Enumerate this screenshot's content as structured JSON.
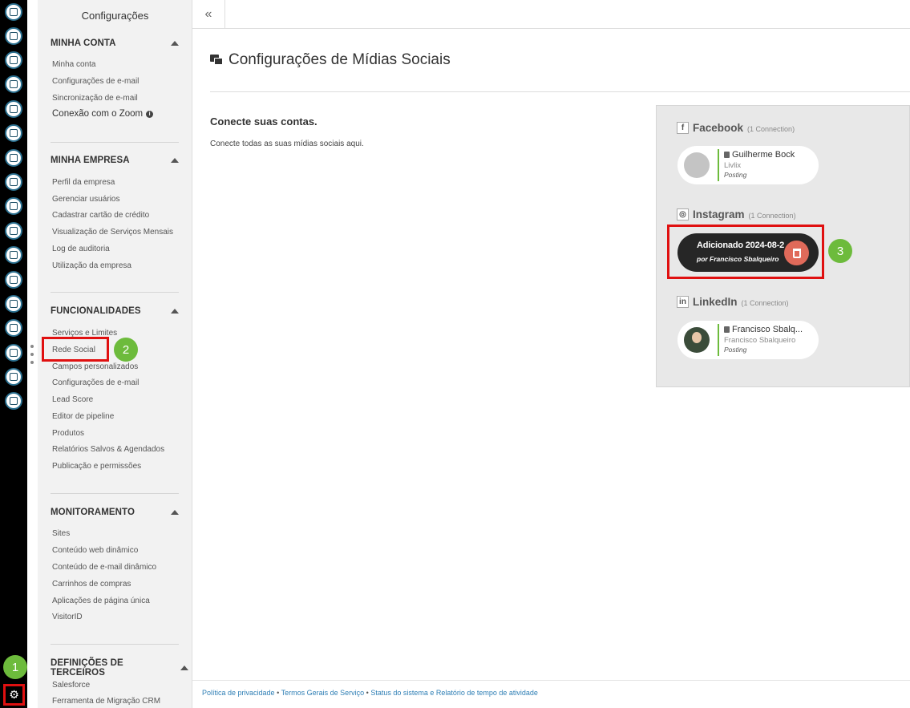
{
  "sidebar": {
    "title": "Configurações",
    "sections": [
      {
        "heading": "MINHA CONTA",
        "items": [
          "Minha conta",
          "Configurações de e-mail",
          "Sincronização de e-mail",
          "Conexão com o Zoom"
        ]
      },
      {
        "heading": "MINHA EMPRESA",
        "items": [
          "Perfil da empresa",
          "Gerenciar usuários",
          "Cadastrar cartão de crédito",
          "Visualização de Serviços Mensais",
          "Log de auditoria",
          "Utilização da empresa"
        ]
      },
      {
        "heading": "FUNCIONALIDADES",
        "items": [
          "Serviços e Limites",
          "Rede Social",
          "Campos personalizados",
          "Configurações de e-mail",
          "Lead Score",
          "Editor de pipeline",
          "Produtos",
          "Relatórios Salvos & Agendados",
          "Publicação e permissões"
        ]
      },
      {
        "heading": "MONITORAMENTO",
        "items": [
          "Sites",
          "Conteúdo web dinâmico",
          "Conteúdo de e-mail dinâmico",
          "Carrinhos de compras",
          "Aplicações de página única",
          "VisitorID"
        ]
      },
      {
        "heading": "DEFINIÇÕES DE TERCEIROS",
        "items": [
          "Salesforce",
          "Ferramenta de Migração CRM"
        ]
      }
    ]
  },
  "rail": {
    "icons": [
      "contacts-icon",
      "inbox-icon",
      "clipboard-icon",
      "map-icon",
      "flow-icon",
      "list-icon",
      "megaphone-icon",
      "face-icon",
      "thumbs-up-icon",
      "images-icon",
      "calendar-icon",
      "handshake-icon",
      "trend-icon",
      "support-icon",
      "add-user-icon",
      "bar-chart-icon",
      "plugin-icon"
    ],
    "settings_icon": "gear-icon"
  },
  "badges": {
    "step1": "1",
    "step2": "2",
    "step3": "3"
  },
  "main": {
    "collapse_label": "«",
    "title": "Configurações de Mídias Sociais",
    "connect_title": "Conecte suas contas.",
    "connect_subtitle": "Conecte todas as suas mídias sociais aqui."
  },
  "networks": {
    "facebook": {
      "icon_glyph": "f",
      "name": "Facebook",
      "count": "(1 Connection)",
      "connection": {
        "name": "Guilherme Bock",
        "org": "Livlix",
        "status": "Posting"
      }
    },
    "instagram": {
      "icon_glyph": "◎",
      "name": "Instagram",
      "count": "(1 Connection)",
      "hover": {
        "added": "Adicionado 2024-08-2",
        "by": "por Francisco Sbalqueiro"
      }
    },
    "linkedin": {
      "icon_glyph": "in",
      "name": "LinkedIn",
      "count": "(1 Connection)",
      "connection": {
        "name": "Francisco Sbalq...",
        "org": "Francisco Sbalqueiro",
        "status": "Posting"
      }
    }
  },
  "footer": {
    "privacy": "Política de privacidade",
    "terms": "Termos Gerais de Serviço",
    "status": "Status do sistema e Relatório de tempo de atividade",
    "separator": "•"
  },
  "colors": {
    "rail": "#000000",
    "sidebar": "#f2f2f2",
    "highlight": "#e01010",
    "badge": "#6dbb3c",
    "trash": "#e06a5a",
    "link": "#2f7fb5"
  }
}
